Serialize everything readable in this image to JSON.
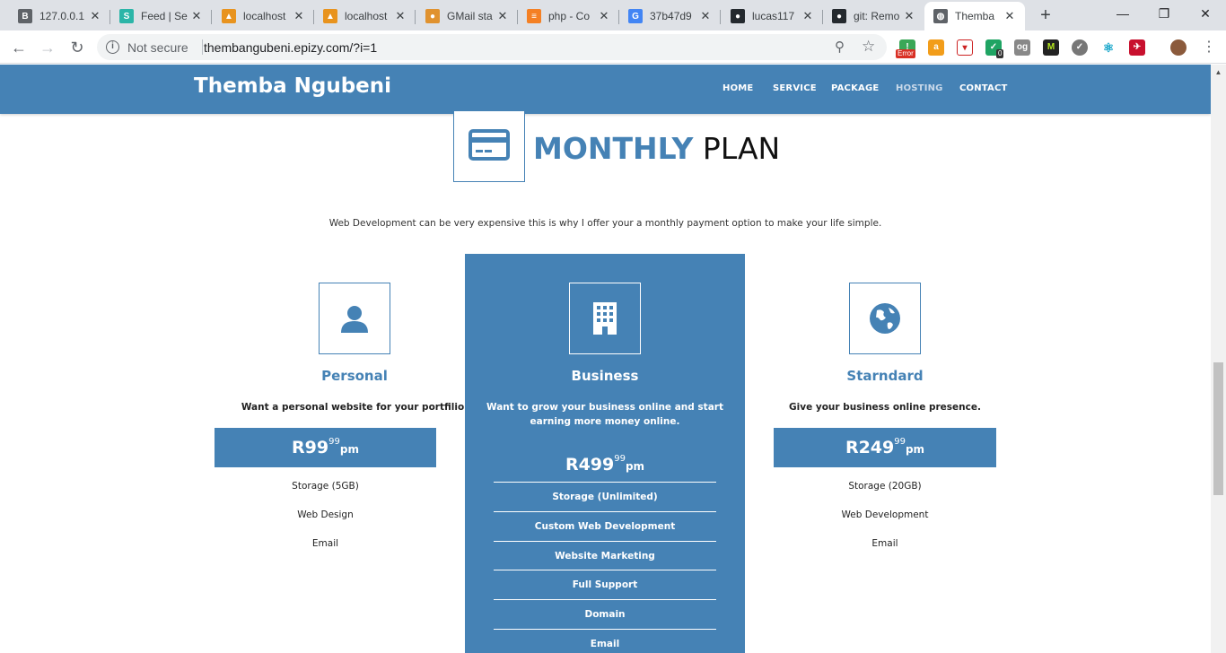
{
  "browser": {
    "tabs": [
      {
        "label": "127.0.0.1",
        "icon": "b-badge-icon",
        "color": "#5f6368",
        "glyph": "B"
      },
      {
        "label": "Feed | Se",
        "icon": "s-badge-icon",
        "color": "#2bb5a8",
        "glyph": "S"
      },
      {
        "label": "localhost",
        "icon": "phpmyadmin-icon",
        "color": "#e8931e",
        "glyph": "▲"
      },
      {
        "label": "localhost",
        "icon": "phpmyadmin-icon",
        "color": "#e8931e",
        "glyph": "▲"
      },
      {
        "label": "GMail sta",
        "icon": "badge-icon",
        "color": "#e0922f",
        "glyph": "●"
      },
      {
        "label": "php - Co",
        "icon": "stackoverflow-icon",
        "color": "#f48024",
        "glyph": "≡"
      },
      {
        "label": "37b47d9",
        "icon": "google-icon",
        "color": "#4285f4",
        "glyph": "G"
      },
      {
        "label": "lucas117",
        "icon": "github-icon",
        "color": "#24292e",
        "glyph": "●"
      },
      {
        "label": "git: Remo",
        "icon": "github-icon",
        "color": "#24292e",
        "glyph": "●"
      },
      {
        "label": "Themba",
        "icon": "globe-icon",
        "color": "#5f6368",
        "glyph": "◍"
      }
    ],
    "close_glyph": "✕",
    "new_tab_glyph": "+",
    "address": {
      "security_label": "Not secure",
      "url": "thembangubeni.epizy.com/?i=1"
    },
    "extension_badge": "Error",
    "extension_count": "0"
  },
  "site": {
    "brand": "Themba Ngubeni",
    "nav": [
      "HOME",
      "SERVICE",
      "PACKAGE",
      "HOSTING",
      "CONTACT"
    ],
    "current_nav": "HOSTING",
    "heading": {
      "accent": "MONTHLY",
      "rest": " PLAN"
    },
    "intro": "Web Development can be very expensive this is why I offer your a monthly payment option to make your life simple.",
    "plans": [
      {
        "name": "Personal",
        "icon": "user-icon",
        "description": "Want a personal website for your portfilio.",
        "price": "R99",
        "cents": "99",
        "period": "pm",
        "features": [
          "Storage (5GB)",
          "Web Design",
          "Email"
        ]
      },
      {
        "name": "Business",
        "icon": "building-icon",
        "description": "Want to grow your business online and start earning more money online.",
        "price": "R499",
        "cents": "99",
        "period": "pm",
        "features": [
          "Storage (Unlimited)",
          "Custom Web Development",
          "Website Marketing",
          "Full Support",
          "Domain",
          "Email"
        ]
      },
      {
        "name": "Starndard",
        "icon": "globe-icon",
        "description": "Give your business online presence.",
        "price": "R249",
        "cents": "99",
        "period": "pm",
        "features": [
          "Storage (20GB)",
          "Web Development",
          "Email"
        ]
      }
    ]
  },
  "colors": {
    "accent": "#4582b5",
    "nav_current": "#c9d9ea"
  }
}
